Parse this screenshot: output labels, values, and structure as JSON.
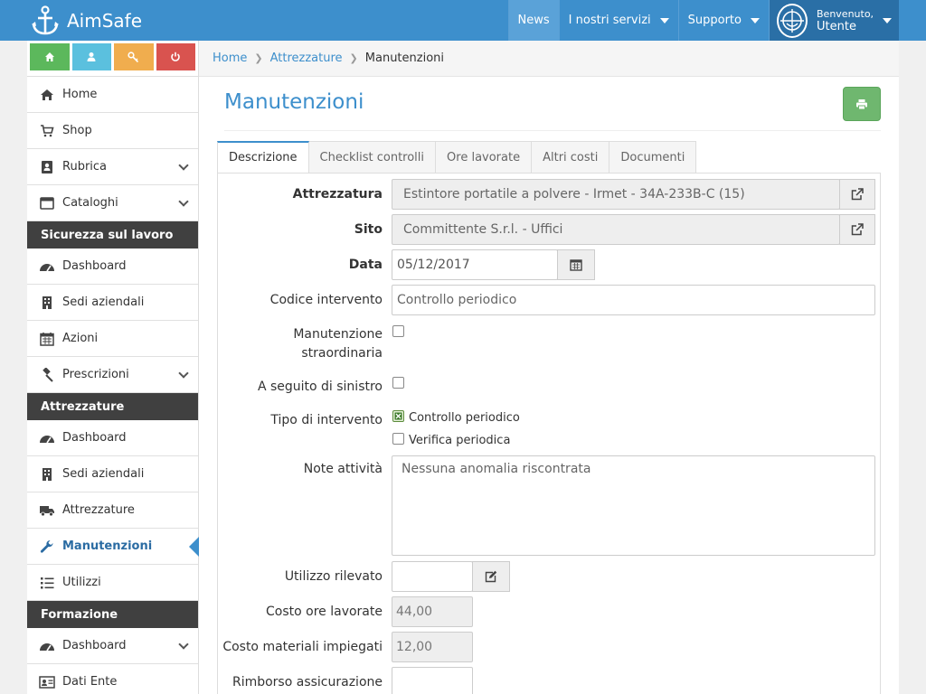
{
  "app": {
    "name": "AimSafe"
  },
  "nav": {
    "news": "News",
    "services": "I nostri servizi",
    "support": "Supporto",
    "welcome": "Benvenuto,",
    "user": "Utente"
  },
  "sidebar": {
    "items_top": [
      {
        "label": "Home",
        "icon": "home-icon"
      },
      {
        "label": "Shop",
        "icon": "cart-icon"
      },
      {
        "label": "Rubrica",
        "icon": "address-book-icon"
      },
      {
        "label": "Cataloghi",
        "icon": "catalog-icon"
      }
    ],
    "section1": "Sicurezza sul lavoro",
    "items_s1": [
      {
        "label": "Dashboard"
      },
      {
        "label": "Sedi aziendali"
      },
      {
        "label": "Azioni"
      },
      {
        "label": "Prescrizioni"
      }
    ],
    "section2": "Attrezzature",
    "items_s2": [
      {
        "label": "Dashboard"
      },
      {
        "label": "Sedi aziendali"
      },
      {
        "label": "Attrezzature"
      },
      {
        "label": "Manutenzioni"
      },
      {
        "label": "Utilizzi"
      }
    ],
    "section3": "Formazione",
    "items_s3": [
      {
        "label": "Dashboard"
      },
      {
        "label": "Dati Ente"
      }
    ]
  },
  "breadcrumb": {
    "home": "Home",
    "parent": "Attrezzature",
    "current": "Manutenzioni"
  },
  "page": {
    "title": "Manutenzioni"
  },
  "tabs": [
    "Descrizione",
    "Checklist controlli",
    "Ore lavorate",
    "Altri costi",
    "Documenti"
  ],
  "form": {
    "attrezzatura": {
      "label": "Attrezzatura",
      "value": "Estintore portatile a polvere - Irmet - 34A-233B-C (15)"
    },
    "sito": {
      "label": "Sito",
      "value": "Committente S.r.l. - Uffici"
    },
    "data": {
      "label": "Data",
      "value": "05/12/2017"
    },
    "codice": {
      "label": "Codice intervento",
      "value": "Controllo periodico"
    },
    "straordinaria": {
      "label_line1": "Manutenzione",
      "label_line2": "straordinaria"
    },
    "sinistro": {
      "label": "A seguito di sinistro"
    },
    "tipo": {
      "label": "Tipo di intervento",
      "opt1": "Controllo periodico",
      "opt2": "Verifica periodica"
    },
    "note": {
      "label": "Note attività",
      "value": "Nessuna anomalia riscontrata"
    },
    "utilizzo": {
      "label": "Utilizzo rilevato",
      "value": ""
    },
    "costo_ore": {
      "label": "Costo ore lavorate",
      "value": "44,00"
    },
    "costo_mat": {
      "label": "Costo materiali impiegati",
      "value": "12,00"
    },
    "rimborso": {
      "label": "Rimborso assicurazione",
      "value": ""
    }
  },
  "colors": {
    "primary": "#3d8fcc",
    "dark": "#404040",
    "success": "#5cb85c"
  }
}
